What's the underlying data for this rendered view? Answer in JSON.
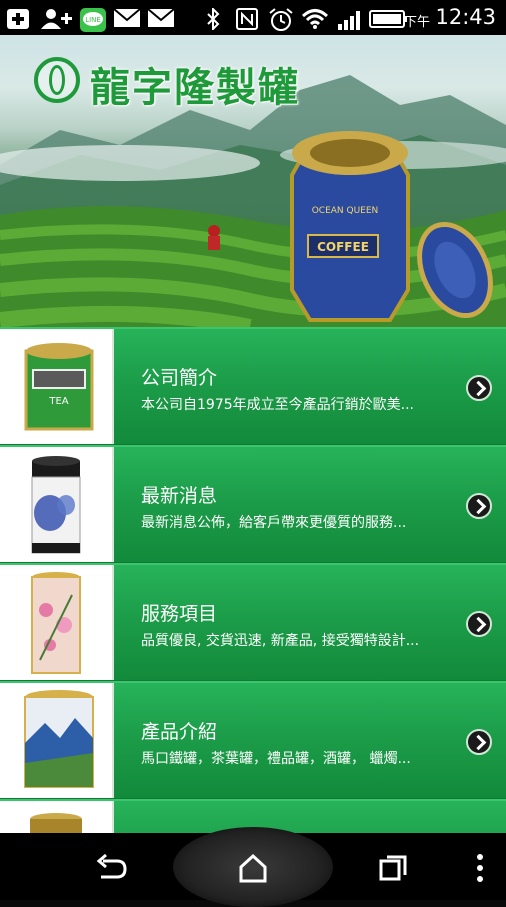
{
  "status_bar": {
    "ampm": "下午",
    "time": "12:43",
    "icons": [
      "add-icon",
      "add-contact-icon",
      "line-app-icon",
      "mail-icon",
      "mail-icon",
      "bluetooth-icon",
      "nfc-icon",
      "alarm-icon",
      "wifi-icon",
      "signal-icon",
      "battery-icon"
    ]
  },
  "header": {
    "brand_name": "龍字隆製罐"
  },
  "menu": {
    "items": [
      {
        "title": "公司簡介",
        "desc": "本公司自1975年成立至今產品行銷於歐美...",
        "thumb": "green-tea-tin"
      },
      {
        "title": "最新消息",
        "desc": "最新消息公佈，給客戶帶來更優質的服務...",
        "thumb": "blue-white-porcelain-tin"
      },
      {
        "title": "服務項目",
        "desc": "品質優良, 交貨迅速, 新產品, 接受獨特設計...",
        "thumb": "pink-floral-tea-tin"
      },
      {
        "title": "產品介紹",
        "desc": "馬口鐵罐，茶葉罐，禮品罐，酒罐， 蠟燭...",
        "thumb": "blue-mountain-tea-tin"
      }
    ]
  },
  "nav_bar": {
    "buttons": [
      "back-icon",
      "home-icon",
      "recent-apps-icon",
      "menu-icon"
    ]
  }
}
